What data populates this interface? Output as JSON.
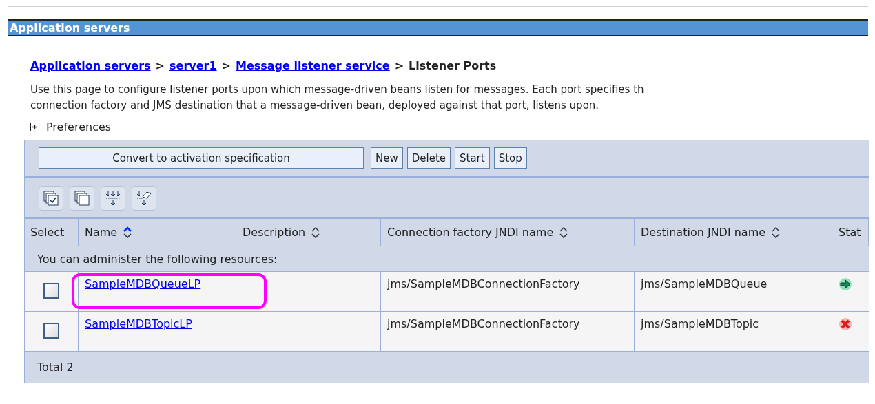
{
  "title_bar": {
    "title": "Application servers"
  },
  "breadcrumb": {
    "links": [
      "Application servers",
      "server1",
      "Message listener service"
    ],
    "separator": ">",
    "current": "Listener Ports"
  },
  "description": [
    "Use this page to configure listener ports upon which message-driven beans listen for messages. Each port specifies th",
    "connection factory and JMS destination that a message-driven bean, deployed against that port, listens upon."
  ],
  "preferences": {
    "label": "Preferences",
    "expanded": false
  },
  "buttons": [
    "Convert to activation specification",
    "New",
    "Delete",
    "Start",
    "Stop"
  ],
  "icon_tools": [
    {
      "kind": "select-all"
    },
    {
      "kind": "deselect-all"
    },
    {
      "kind": "filter"
    },
    {
      "kind": "clear-filter"
    }
  ],
  "table": {
    "columns": [
      {
        "label": "Select",
        "sortable": false
      },
      {
        "label": "Name",
        "sortable": true,
        "sorted": true
      },
      {
        "label": "Description",
        "sortable": true,
        "sorted": false
      },
      {
        "label": "Connection factory JNDI name",
        "sortable": true,
        "sorted": false
      },
      {
        "label": "Destination JNDI name",
        "sortable": true,
        "sorted": false
      },
      {
        "label": "Stat",
        "sortable": false
      }
    ],
    "group_label": "You can administer the following resources:",
    "rows": [
      {
        "checked": false,
        "name": "SampleMDBQueueLP",
        "connection_factory": "jms/SampleMDBConnectionFactory",
        "destination": "jms/SampleMDBQueue",
        "kind": "started",
        "highlighted": true
      },
      {
        "checked": false,
        "name": "SampleMDBTopicLP",
        "connection_factory": "jms/SampleMDBConnectionFactory",
        "destination": "jms/SampleMDBTopic",
        "kind": "stopped",
        "highlighted": false
      }
    ],
    "total": "Total 2"
  }
}
